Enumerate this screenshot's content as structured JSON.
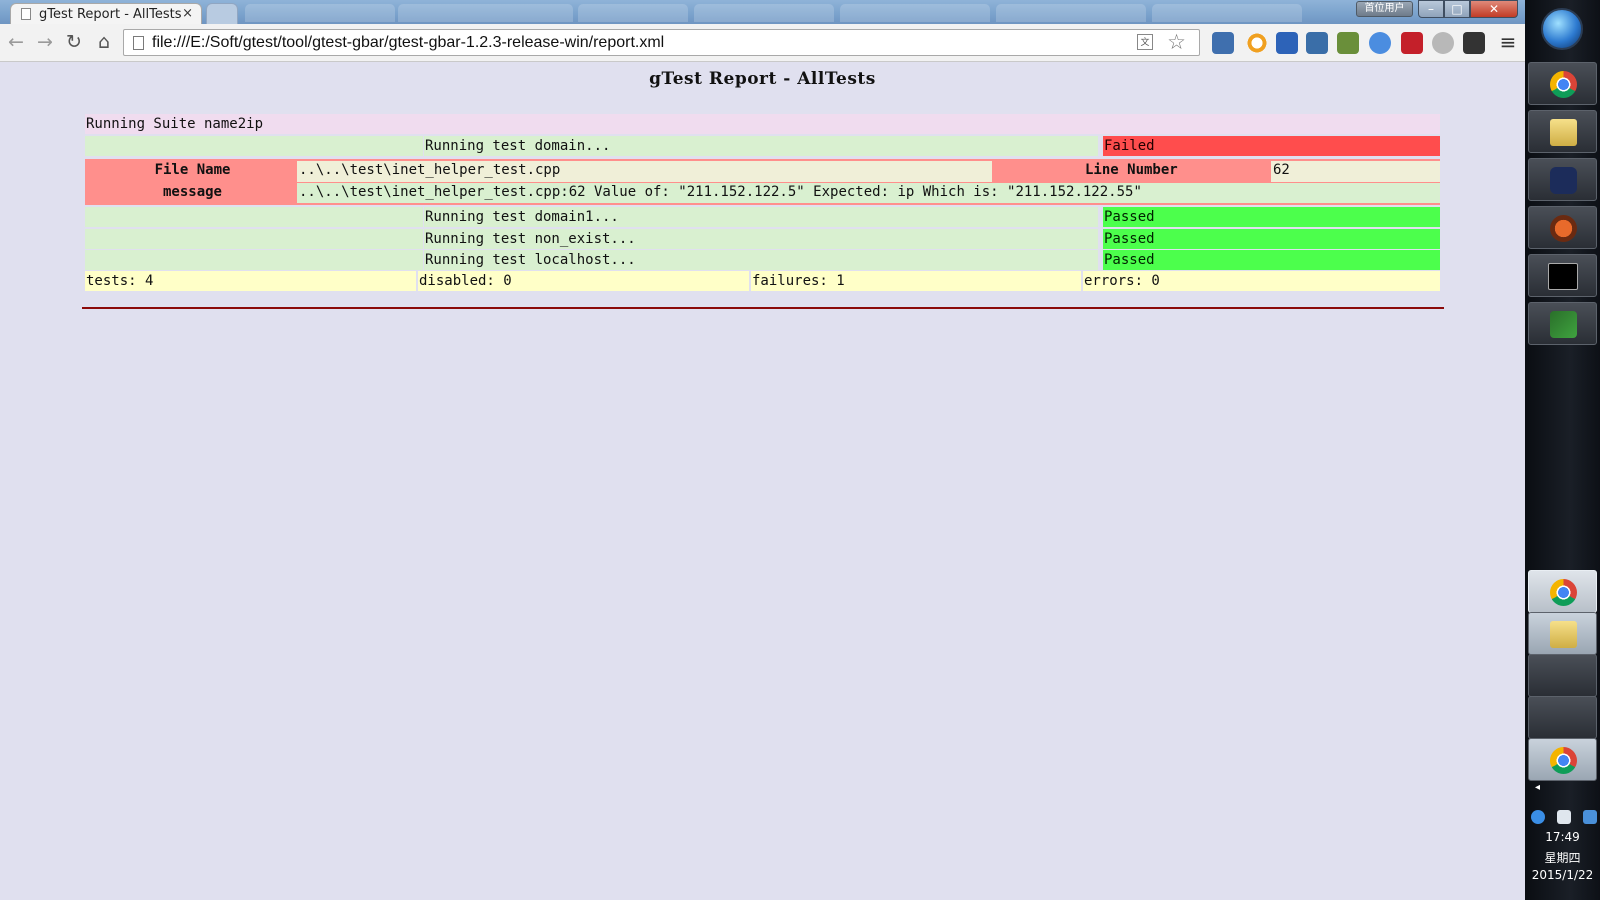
{
  "browser": {
    "tab_title": "gTest Report - AllTests",
    "tab_close": "×",
    "win_user_label": "首位用户",
    "win_min": "–",
    "win_max": "□",
    "win_close": "✕",
    "back_icon": "←",
    "forward_icon": "→",
    "reload_icon": "↻",
    "home_icon": "⌂",
    "url": "file:///E:/Soft/gtest/tool/gtest-gbar/gtest-gbar-1.2.3-release-win/report.xml",
    "translate_icon": "文",
    "bookmark_icon": "☆",
    "menu_icon": "≡"
  },
  "report": {
    "title": "gTest Report - AllTests",
    "suite": "Running Suite name2ip",
    "tests": [
      {
        "name": "Running test domain...",
        "result": "Failed"
      },
      {
        "name": "Running test domain1...",
        "result": "Passed"
      },
      {
        "name": "Running test non_exist...",
        "result": "Passed"
      },
      {
        "name": "Running test localhost...",
        "result": "Passed"
      }
    ],
    "failure": {
      "file_label": "File Name",
      "file_value": "..\\..\\test\\inet_helper_test.cpp",
      "line_label": "Line Number",
      "line_value": "62",
      "message_label": "message",
      "message_value": "..\\..\\test\\inet_helper_test.cpp:62 Value of: \"211.152.122.5\" Expected: ip Which is: \"211.152.122.55\""
    },
    "summary": {
      "tests": "tests: 4",
      "disabled": "disabled: 0",
      "failures": "failures: 1",
      "errors": "errors: 0"
    },
    "colors": {
      "failed": "#ff4d4d",
      "passed": "#4cff4c",
      "failure_box": "#ff8f8c",
      "rule": "#8b0a0a"
    }
  },
  "taskbar": {
    "pinned_icons": [
      "chrome-icon",
      "folder-icon",
      "visual-studio-icon",
      "git-icon",
      "cmd-icon",
      "vim-icon"
    ],
    "running_icons": [
      "chrome-icon",
      "folder-icon",
      "blank",
      "blank",
      "chrome-icon"
    ],
    "tray_arrow": "◂",
    "time": "17:49",
    "weekday": "星期四",
    "date": "2015/1/22"
  }
}
